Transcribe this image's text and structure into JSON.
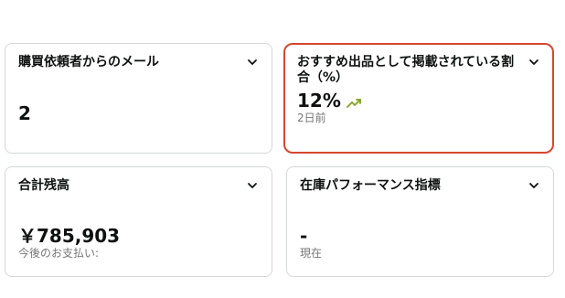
{
  "cards": [
    {
      "title": "購買依頼者からのメール",
      "value": "2"
    },
    {
      "title": "おすすめ出品として掲載されている割合（%）",
      "value": "12%",
      "sub": "2日前",
      "trend": "up",
      "trend_color": "#7fa31d",
      "border_color": "#d6472f"
    },
    {
      "title": "合計残高",
      "value": "￥785,903",
      "sub": "今後のお支払い:"
    },
    {
      "title": "在庫パフォーマンス指標",
      "value": "-",
      "sub": "現在"
    }
  ],
  "icons": {
    "dropdown": "chevron-down-icon",
    "trend": "trend-up-icon"
  }
}
